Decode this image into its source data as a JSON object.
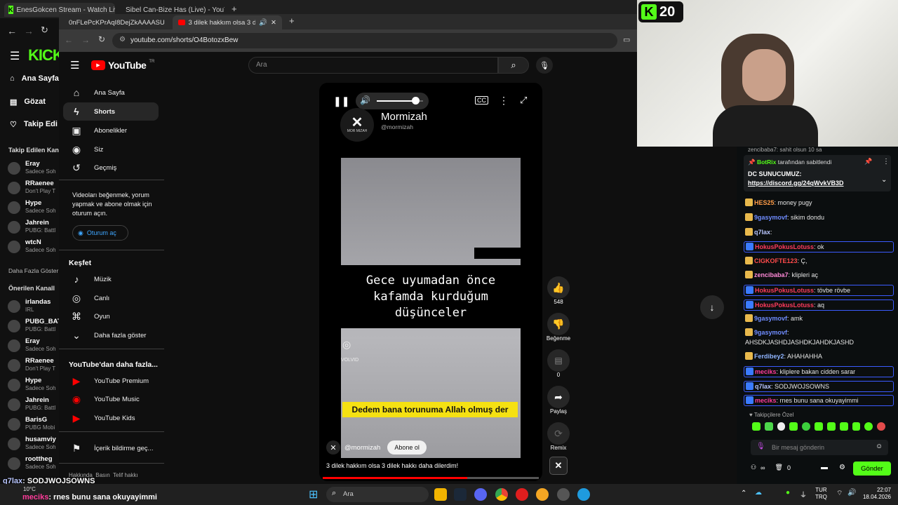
{
  "outer_browser": {
    "tabs": [
      "EnesGokcen Stream - Watch Live",
      "Sibel Can-Bize Has (Live) - YouT"
    ]
  },
  "kick": {
    "logo": "KICK",
    "nav": [
      "Ana Sayfa",
      "Gözat",
      "Takip Edi"
    ],
    "followed_heading": "Takip Edilen Kan",
    "followed": [
      {
        "name": "Eray",
        "sub": "Sadece Soh"
      },
      {
        "name": "RRaenee",
        "sub": "Don't Play T"
      },
      {
        "name": "Hype",
        "sub": "Sadece Soh"
      },
      {
        "name": "Jahrein",
        "sub": "PUBG: Battl"
      },
      {
        "name": "wtcN",
        "sub": "Sadece Soh"
      }
    ],
    "more_label": "Daha Fazla Göster",
    "recommended_heading": "Önerilen Kanall",
    "recommended": [
      {
        "name": "irlandas",
        "sub": "IRL"
      },
      {
        "name": "PUBG_BAT",
        "sub": "PUBG: Battl"
      },
      {
        "name": "Eray",
        "sub": "Sadece Soh"
      },
      {
        "name": "RRaenee",
        "sub": "Don't Play T"
      },
      {
        "name": "Hype",
        "sub": "Sadece Soh"
      },
      {
        "name": "Jahrein",
        "sub": "PUBG: Battl"
      },
      {
        "name": "BarisG",
        "sub": "PUBG Mobi"
      },
      {
        "name": "husamviy",
        "sub": "Sadece Soh"
      },
      {
        "name": "roottheg",
        "sub": "Sadece Soh"
      }
    ],
    "kick_badge": "20"
  },
  "inner_browser": {
    "tabs": [
      "0nFLePcKPrAqI8DejZkAAAASU",
      "3 dilek hakkım olsa 3 dilek"
    ],
    "url": "youtube.com/shorts/O4BotozxBew"
  },
  "youtube": {
    "logo_text": "YouTube",
    "country": "TR",
    "search_placeholder": "Ara",
    "nav": [
      "Ana Sayfa",
      "Shorts",
      "Abonelikler",
      "Siz",
      "Geçmiş"
    ],
    "signin_prompt": "Videoları beğenmek, yorum yapmak ve abone olmak için oturum açın.",
    "signin_button": "Oturum aç",
    "explore_heading": "Keşfet",
    "explore": [
      "Müzik",
      "Canlı",
      "Oyun",
      "Daha fazla göster"
    ],
    "more_heading": "YouTube'dan daha fazla...",
    "more": [
      "YouTube Premium",
      "YouTube Music",
      "YouTube Kids"
    ],
    "report": "İçerik bildirme geç...",
    "footer": "Hakkında  Basın  Telif hakkı",
    "short": {
      "channel": "Mormizah",
      "handle": "@mormizah",
      "logo_caption": "MOR MIZAH",
      "caption": "Gece uyumadan önce kafamda kurduğum düşünceler",
      "overlay": "Dedem bana torunuma Allah olmuş der",
      "watermark": "VOLVID",
      "bottom_handle": "@mormizah",
      "subscribe": "Abone ol",
      "title": "3 dilek hakkım olsa 3 dilek hakkı daha dilerdim!",
      "volume": 0.84,
      "progress": 0.67
    },
    "actions": {
      "likes": "548",
      "dislike_label": "Beğenme",
      "comments": "0",
      "share_label": "Paylaş",
      "remix_label": "Remix"
    }
  },
  "chat": {
    "top_cut": "zencibaba7: sahit olsun 10 sa",
    "pinned_by": "BotRix",
    "pinned_suffix": " tarafından sabitlendi",
    "pinned_title": "DC SUNUCUMUZ:",
    "pinned_link": "https://discord.gg/24qWvkVB3D",
    "messages": [
      {
        "user": "HES25",
        "text": ": money pugy",
        "color": "#ff9c47",
        "hl": false
      },
      {
        "user": "9gasymovf",
        "text": ": sikim dondu",
        "color": "#6f8cff",
        "hl": false
      },
      {
        "user": "q7lax",
        "text": ":",
        "color": "#b9c6ff",
        "hl": false
      },
      {
        "user": "HokusPokusLotuss",
        "text": ": ok",
        "color": "#ff3b5c",
        "hl": true
      },
      {
        "user": "CIGKOFTE123",
        "text": ": Ç,",
        "color": "#ff4b4b",
        "hl": false
      },
      {
        "user": "zencibaba7",
        "text": ": klipleri aç",
        "color": "#ff8ad8",
        "hl": false
      },
      {
        "user": "HokusPokusLotuss",
        "text": ": tövbe rövbe",
        "color": "#ff3b5c",
        "hl": true
      },
      {
        "user": "HokusPokusLotuss",
        "text": ": aq",
        "color": "#ff3b5c",
        "hl": true
      },
      {
        "user": "9gasymovf",
        "text": ": amk",
        "color": "#6f8cff",
        "hl": false
      },
      {
        "user": "9gasymovf",
        "text": ":",
        "color": "#6f8cff",
        "hl": false
      },
      {
        "user": "",
        "text": "AHSDKJASHDJASHDKJAHDKJASHD",
        "color": "#ffffff",
        "hl": false
      },
      {
        "user": "Ferdibey2",
        "text": ": AHAHAHHA",
        "color": "#8fb4ff",
        "hl": false
      },
      {
        "user": "meciks",
        "text": ": kliplere bakan cidden sarar",
        "color": "#ff3b9a",
        "hl": true
      },
      {
        "user": "q7lax",
        "text": ": SODJWOJSOWNS",
        "color": "#b9c6ff",
        "hl": true
      },
      {
        "user": "meciks",
        "text": ": rnes bunu sana okuyayimmi",
        "color": "#ff3b9a",
        "hl": true
      }
    ],
    "followers_only": "Takipçilere Özel",
    "input_placeholder": "Bir mesaj gönderin",
    "viewers": "0",
    "send_button": "Gönder"
  },
  "overlay_chat": {
    "line1_user": "q7lax",
    "line1_text": ": SODJWOJSOWNS",
    "line2_user": "meciks",
    "line2_text": ": rnes bunu sana okuyayimmi"
  },
  "taskbar": {
    "weather": "10°C",
    "search": "Ara",
    "lang1": "TUR",
    "lang2": "TRQ",
    "time": "22:07",
    "date": "18.04.2026"
  },
  "colors": {
    "kick_green": "#53fc18",
    "yt_red": "#ff0000",
    "accent_blue": "#3ea6ff"
  }
}
